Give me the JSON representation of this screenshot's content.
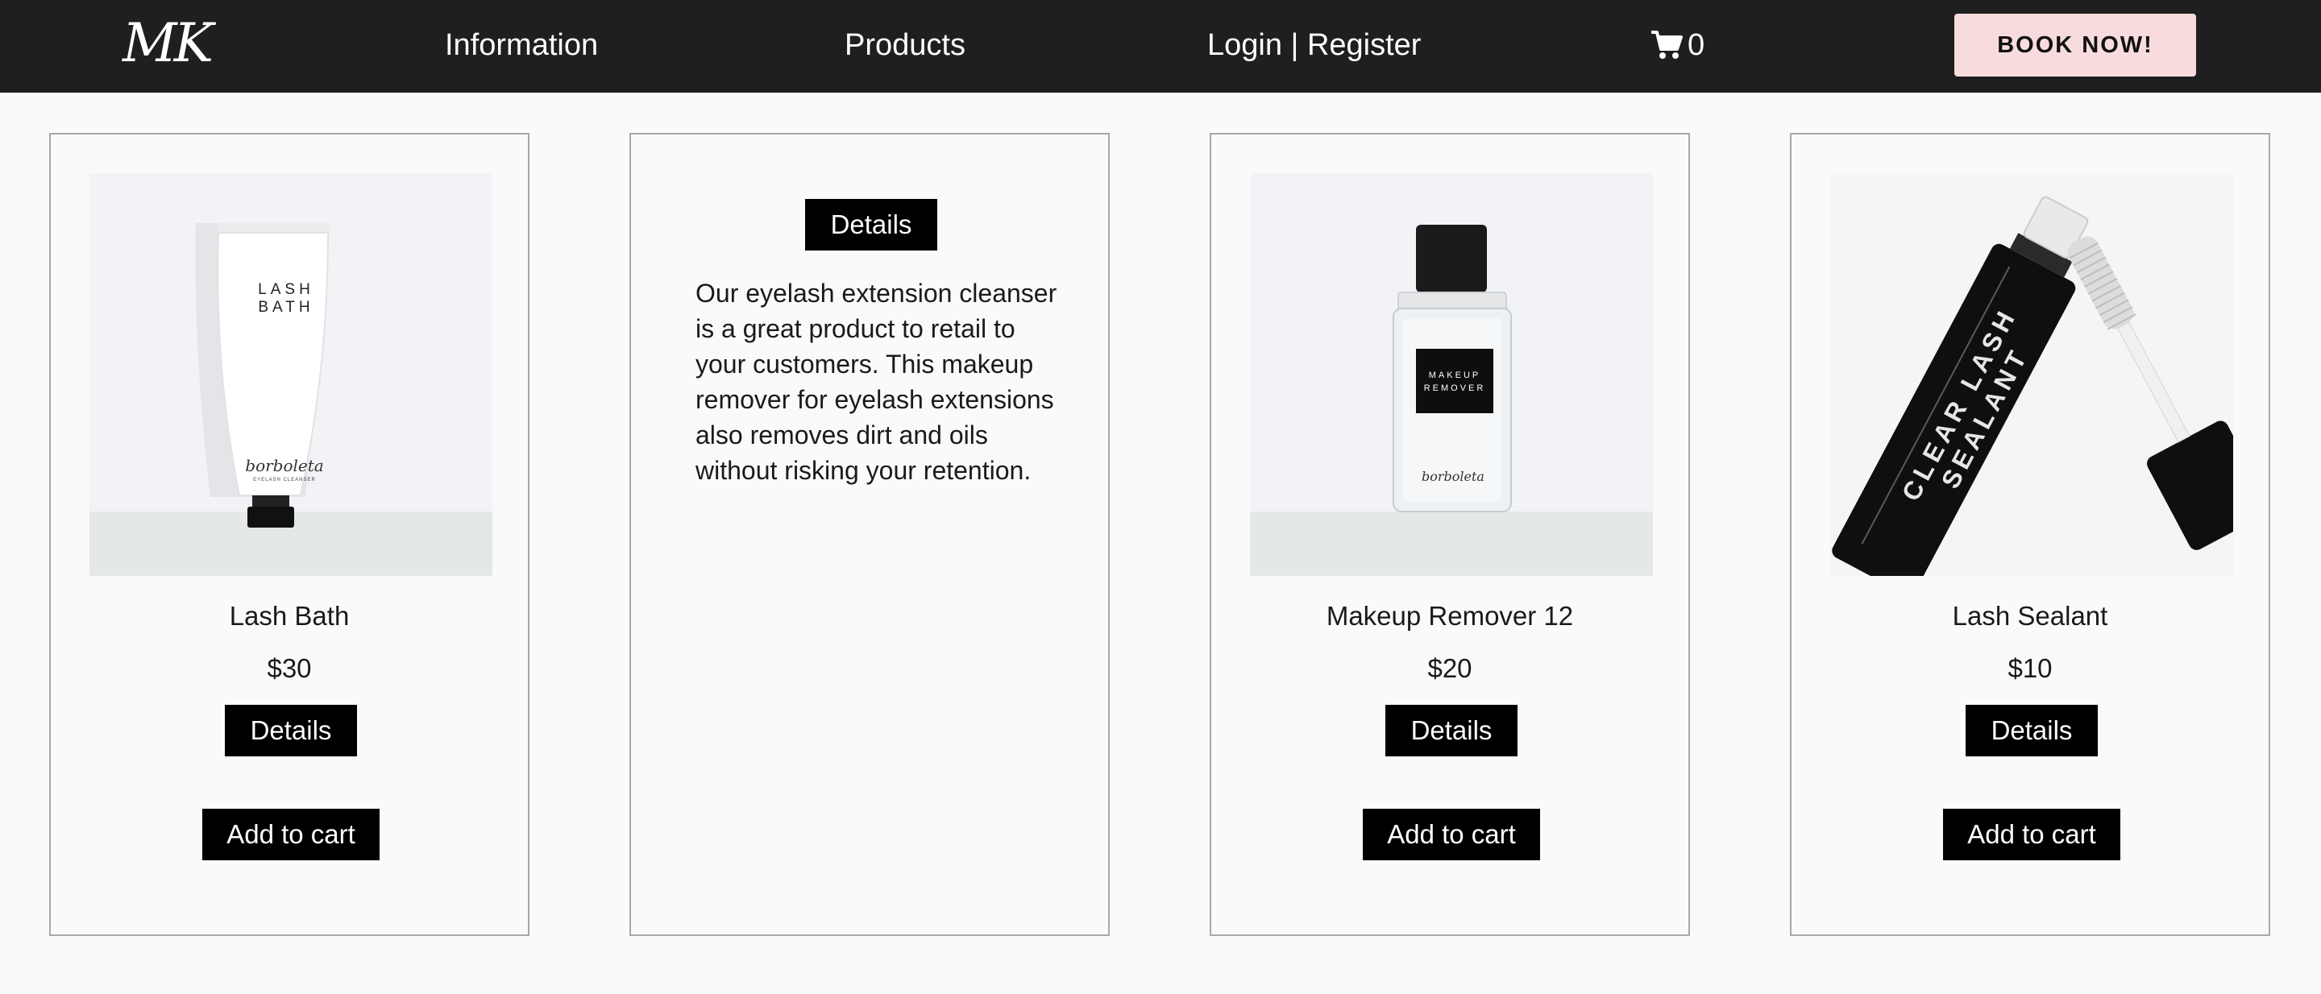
{
  "nav": {
    "logo": "MK",
    "links": [
      "Information",
      "Products",
      "Login | Register"
    ],
    "cart_count": "0",
    "book_label": "BOOK NOW!",
    "colors": {
      "bar": "#1f1f1f",
      "book_button": "#f8dcdd"
    },
    "icons": {
      "cart": "shopping-cart-icon"
    }
  },
  "products": [
    {
      "name": "Lash Bath",
      "price": "$30",
      "details_label": "Details",
      "cart_label": "Add to cart",
      "image_text": [
        "LASH",
        "BATH",
        "borboleta",
        "EYELASH CLEANSER"
      ]
    },
    {
      "details_label": "Details",
      "description": "Our eyelash extension cleanser is a great product to retail to your customers. This makeup remover for eyelash extensions also removes dirt and oils without risking your retention."
    },
    {
      "name": "Makeup Remover 12",
      "price": "$20",
      "details_label": "Details",
      "cart_label": "Add to cart",
      "image_text": [
        "MAKEUP",
        "REMOVER",
        "borboleta"
      ]
    },
    {
      "name": "Lash Sealant",
      "price": "$10",
      "details_label": "Details",
      "cart_label": "Add to cart",
      "image_text": [
        "CLEAR LASH",
        "SEALANT"
      ]
    }
  ]
}
